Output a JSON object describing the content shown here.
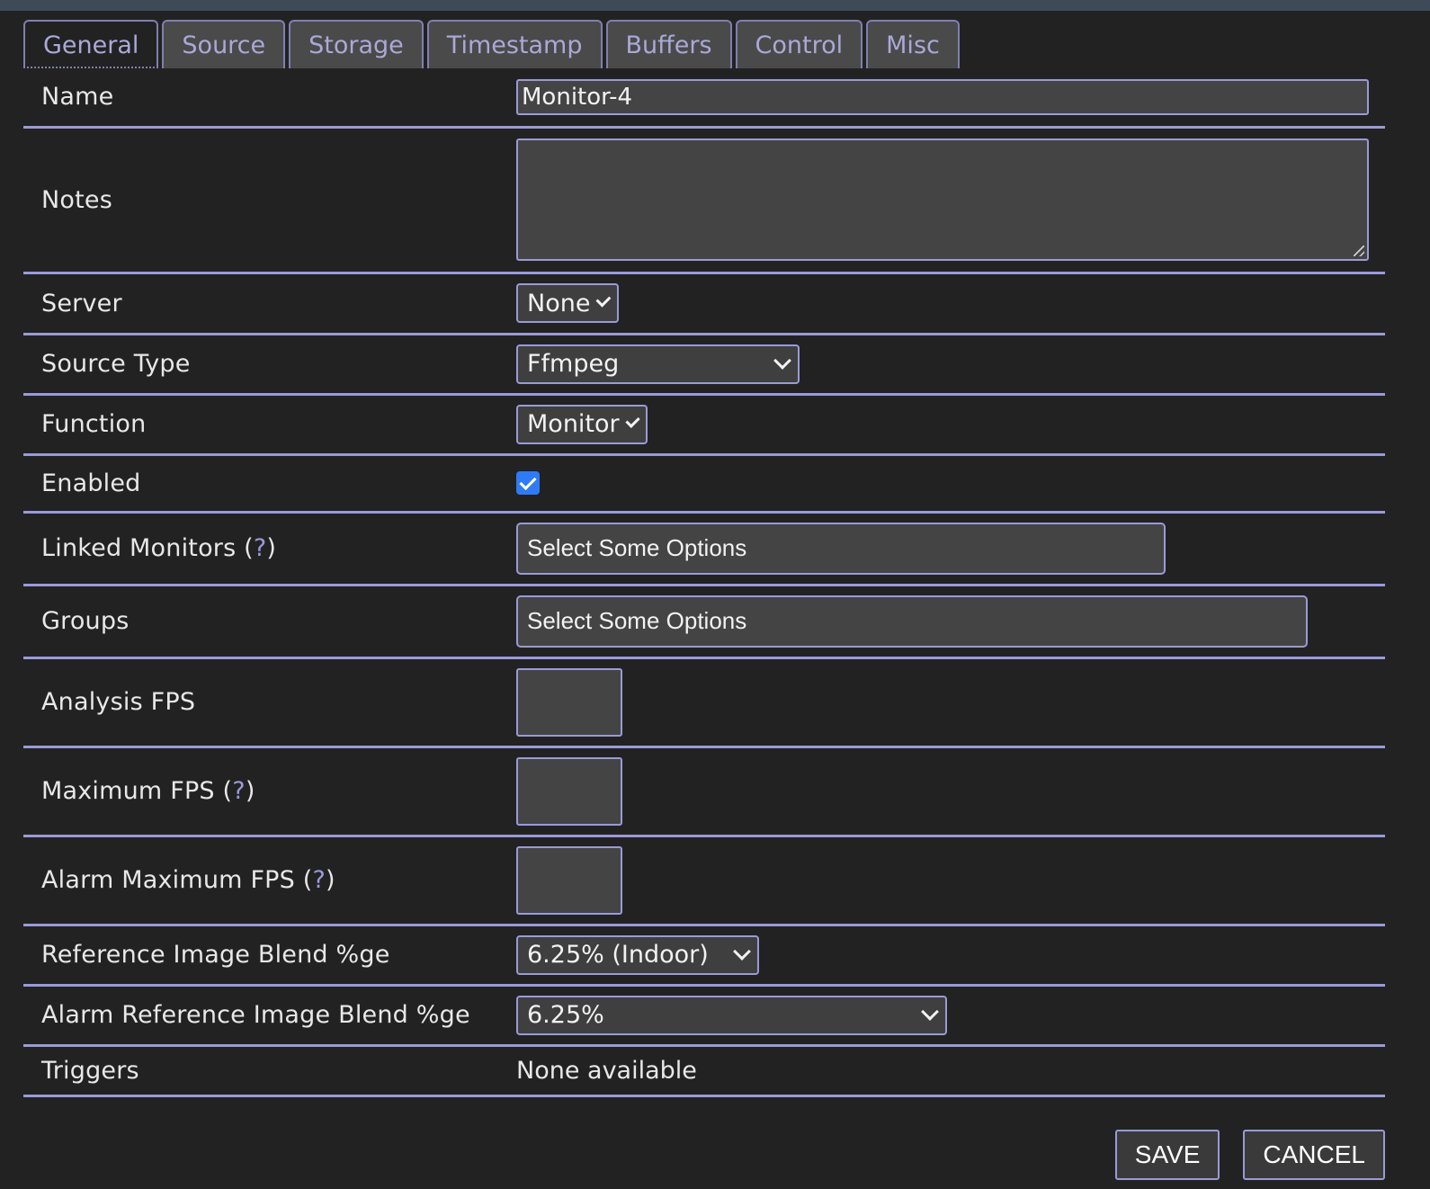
{
  "tabs": [
    "General",
    "Source",
    "Storage",
    "Timestamp",
    "Buffers",
    "Control",
    "Misc"
  ],
  "active_tab": "General",
  "form": {
    "name": {
      "label": "Name",
      "value": "Monitor-4"
    },
    "notes": {
      "label": "Notes",
      "value": ""
    },
    "server": {
      "label": "Server",
      "value": "None"
    },
    "source_type": {
      "label": "Source Type",
      "value": "Ffmpeg"
    },
    "function": {
      "label": "Function",
      "value": "Monitor"
    },
    "enabled": {
      "label": "Enabled",
      "checked": true
    },
    "linked_monitors": {
      "label": "Linked Monitors (",
      "help": "?",
      "label_end": ")",
      "placeholder": "Select Some Options"
    },
    "groups": {
      "label": "Groups",
      "placeholder": "Select Some Options"
    },
    "analysis_fps": {
      "label": "Analysis FPS",
      "value": ""
    },
    "maximum_fps": {
      "label": "Maximum FPS (",
      "help": "?",
      "label_end": ")",
      "value": ""
    },
    "alarm_maximum_fps": {
      "label": "Alarm Maximum FPS (",
      "help": "?",
      "label_end": ")",
      "value": ""
    },
    "ref_blend": {
      "label": "Reference Image Blend %ge",
      "value": "6.25% (Indoor)"
    },
    "alarm_ref_blend": {
      "label": "Alarm Reference Image Blend %ge",
      "value": "6.25%"
    },
    "triggers": {
      "label": "Triggers",
      "value": "None available"
    }
  },
  "buttons": {
    "save": "SAVE",
    "cancel": "CANCEL"
  },
  "colors": {
    "background": "#222222",
    "accent": "#9a9ad8",
    "checkbox": "#2f7bf5",
    "field": "#444444"
  }
}
